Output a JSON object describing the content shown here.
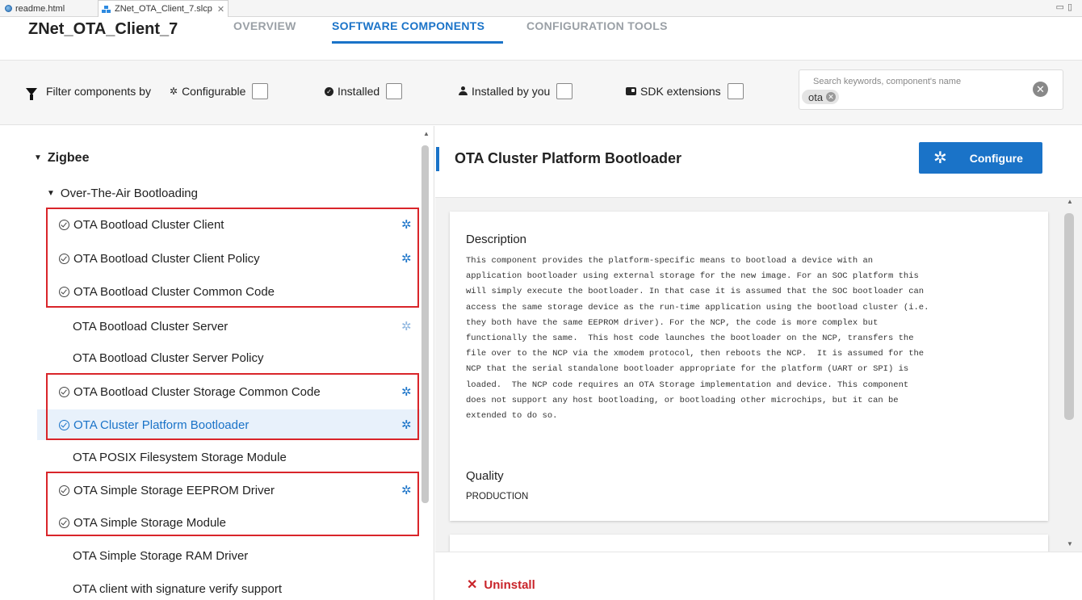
{
  "editor_tabs": [
    {
      "label": "readme.html",
      "icon": "globe-icon"
    },
    {
      "label": "ZNet_OTA_Client_7.slcp",
      "icon": "project-icon"
    }
  ],
  "header": {
    "project_title": "ZNet_OTA_Client_7",
    "tabs": [
      "OVERVIEW",
      "SOFTWARE COMPONENTS",
      "CONFIGURATION TOOLS"
    ],
    "active_tab": "SOFTWARE COMPONENTS"
  },
  "filters": {
    "label": "Filter components by",
    "configurable": "Configurable",
    "installed": "Installed",
    "installed_by_you": "Installed by you",
    "sdk_extensions": "SDK extensions"
  },
  "search": {
    "placeholder": "Search keywords, component's name",
    "chip": "ota"
  },
  "tree": {
    "category": "Zigbee",
    "subcategory": "Over-The-Air Bootloading",
    "components": [
      {
        "name": "OTA Bootload Cluster Client",
        "installed": true,
        "configurable": true
      },
      {
        "name": "OTA Bootload Cluster Client Policy",
        "installed": true,
        "configurable": true
      },
      {
        "name": "OTA Bootload Cluster Common Code",
        "installed": true,
        "configurable": false
      },
      {
        "name": "OTA Bootload Cluster Server",
        "installed": false,
        "configurable": true
      },
      {
        "name": "OTA Bootload Cluster Server Policy",
        "installed": false,
        "configurable": false
      },
      {
        "name": "OTA Bootload Cluster Storage Common Code",
        "installed": true,
        "configurable": true
      },
      {
        "name": "OTA Cluster Platform Bootloader",
        "installed": true,
        "configurable": true,
        "selected": true
      },
      {
        "name": "OTA POSIX Filesystem Storage Module",
        "installed": false,
        "configurable": false
      },
      {
        "name": "OTA Simple Storage EEPROM Driver",
        "installed": true,
        "configurable": true
      },
      {
        "name": "OTA Simple Storage Module",
        "installed": true,
        "configurable": false
      },
      {
        "name": "OTA Simple Storage RAM Driver",
        "installed": false,
        "configurable": false
      },
      {
        "name": "OTA client with signature verify support",
        "installed": false,
        "configurable": false
      }
    ]
  },
  "detail": {
    "title": "OTA Cluster Platform Bootloader",
    "configure_label": "Configure",
    "description_heading": "Description",
    "description": "This component provides the platform-specific means to bootload a device with an\napplication bootloader using external storage for the new image. For an SOC platform this\nwill simply execute the bootloader. In that case it is assumed that the SOC bootloader can\naccess the same storage device as the run-time application using the bootload cluster (i.e.\nthey both have the same EEPROM driver). For the NCP, the code is more complex but\nfunctionally the same.  This host code launches the bootloader on the NCP, transfers the\nfile over to the NCP via the xmodem protocol, then reboots the NCP.  It is assumed for the\nNCP that the serial standalone bootloader appropriate for the platform (UART or SPI) is\nloaded.  The NCP code requires an OTA Storage implementation and device. This component\ndoes not support any host bootloading, or bootloading other microchips, but it can be\nextended to do so.",
    "quality_heading": "Quality",
    "quality": "PRODUCTION",
    "uninstall_label": "Uninstall"
  },
  "colors": {
    "accent": "#1a73c8",
    "highlight_box": "#d9252a",
    "uninstall": "#c9242a"
  }
}
